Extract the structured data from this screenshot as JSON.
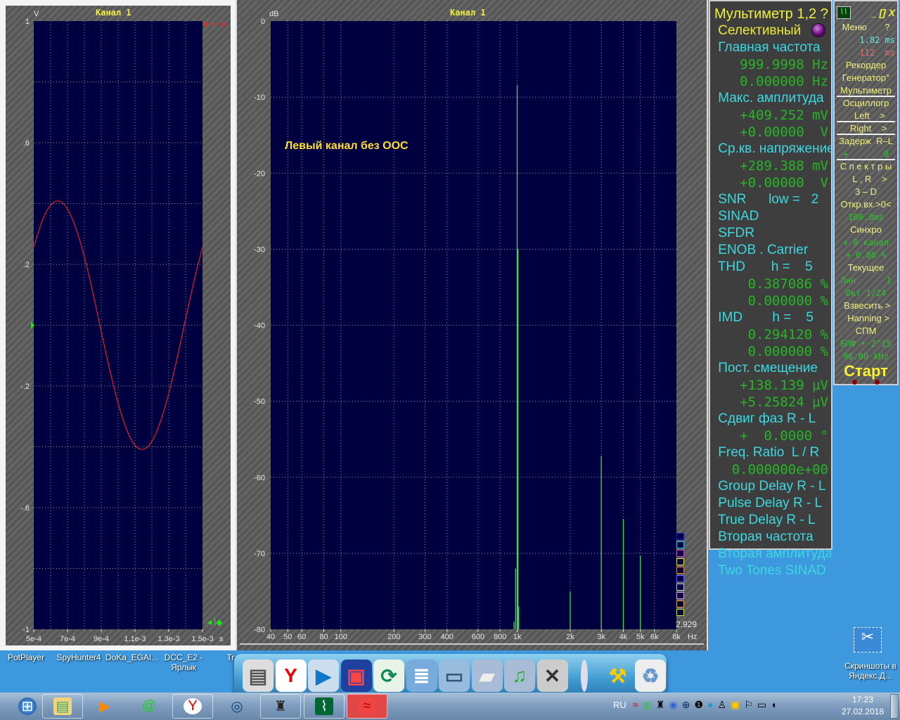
{
  "scope": {
    "title": "Канал 1",
    "unit_label": "V",
    "marker_text": "0 = 0",
    "trigger_icon": "trigger-marker-icon",
    "cursor_controls_icon": "cursor-controls-icon"
  },
  "spectrum": {
    "title": "Канал 1",
    "annotation": "Левый канал без ООС",
    "unit_label": "dB",
    "scale_value": "2.929",
    "legend_colors": [
      "#2020c0",
      "#40c0e0",
      "#c040c0",
      "#e0e040",
      "#e08040",
      "#6060ff",
      "#c0c0e0",
      "#e0a0e0",
      "#e0a040",
      "#c0e040"
    ]
  },
  "chart_data": [
    {
      "type": "line",
      "title": "Канал 1",
      "ylabel": "V",
      "xlabel": "s",
      "xlim": [
        0.0005,
        0.0015
      ],
      "ylim": [
        -1,
        1
      ],
      "grid": true,
      "x_ticks": [
        "5e-4",
        "7e-4",
        "9e-4",
        "1.1e-3",
        "1.3e-3",
        "1.5e-3"
      ],
      "x_tick_values": [
        0.0005,
        0.0007,
        0.0009,
        0.0011,
        0.0013,
        0.0015
      ],
      "y_ticks": [
        "1",
        ".6",
        ".2",
        "-.2",
        "-.6",
        "-1"
      ],
      "y_tick_values": [
        1,
        0.6,
        0.2,
        -0.2,
        -0.6,
        -1
      ],
      "series_color": "#e02020",
      "x": [
        0.0005,
        0.00055,
        0.0006,
        0.00065,
        0.0007,
        0.00075,
        0.0008,
        0.00085,
        0.0009,
        0.00095,
        0.001,
        0.00105,
        0.0011,
        0.00115,
        0.0012,
        0.00125,
        0.0013,
        0.00135,
        0.0014,
        0.00145,
        0.0015
      ],
      "y": [
        0.257,
        0.343,
        0.395,
        0.408,
        0.382,
        0.318,
        0.224,
        0.107,
        -0.021,
        -0.146,
        -0.257,
        -0.343,
        -0.395,
        -0.408,
        -0.382,
        -0.318,
        -0.224,
        -0.107,
        0.021,
        0.146,
        0.257
      ]
    },
    {
      "type": "bar",
      "title": "Канал 1",
      "ylabel": "dB",
      "xlabel": "Hz",
      "x_scale": "log",
      "xlim": [
        40,
        8000
      ],
      "ylim": [
        -80,
        0
      ],
      "grid": true,
      "x_ticks": [
        "40",
        "50",
        "60",
        "80",
        "100",
        "200",
        "300",
        "400",
        "600",
        "800",
        "1k",
        "2k",
        "3k",
        "4k",
        "5k",
        "6k",
        "8k"
      ],
      "x_tick_values": [
        40,
        50,
        60,
        80,
        100,
        200,
        300,
        400,
        600,
        800,
        1000,
        2000,
        3000,
        4000,
        5000,
        6000,
        8000
      ],
      "y_ticks": [
        "0",
        "-10",
        "-20",
        "-30",
        "-40",
        "-50",
        "-60",
        "-70",
        "-80"
      ],
      "y_tick_values": [
        0,
        -10,
        -20,
        -30,
        -40,
        -50,
        -60,
        -70,
        -80
      ],
      "series_color": "#40e040",
      "x": [
        960,
        980,
        1000,
        1010,
        1020,
        2000,
        3000,
        4000,
        5000
      ],
      "y": [
        -79,
        -72,
        -8.4,
        -30,
        -77,
        -75,
        -57.2,
        -65.5,
        -70.3
      ]
    }
  ],
  "multimeter": {
    "rows": [
      {
        "text": "Мультиметр 1,2 ?",
        "kind": "mt"
      },
      {
        "text": " Селективный",
        "kind": "mh"
      },
      {
        "text": " Главная частота",
        "kind": "ml"
      },
      {
        "text": "999.9998 Hz",
        "kind": "mv"
      },
      {
        "text": "0.000000 Hz",
        "kind": "mv"
      },
      {
        "text": " Макс. амплитуда",
        "kind": "ml"
      },
      {
        "text": "+409.252 mV",
        "kind": "mv"
      },
      {
        "text": "+0.00000  V",
        "kind": "mv"
      },
      {
        "text": " Ср.кв. напряжение",
        "kind": "ml"
      },
      {
        "text": "+289.388 mV",
        "kind": "mv"
      },
      {
        "text": "+0.00000  V",
        "kind": "mv"
      },
      {
        "text": " SNR      low =   2",
        "kind": "ml"
      },
      {
        "text": " SINAD",
        "kind": "ml"
      },
      {
        "text": " SFDR",
        "kind": "ml"
      },
      {
        "text": " ENOB . Carrier",
        "kind": "ml"
      },
      {
        "text": " THD       h =    5",
        "kind": "ml"
      },
      {
        "text": "0.387086 %",
        "kind": "mv"
      },
      {
        "text": "0.000000 %",
        "kind": "mv"
      },
      {
        "text": " IMD        h =    5",
        "kind": "ml"
      },
      {
        "text": "0.294120 %",
        "kind": "mv"
      },
      {
        "text": "0.000000 %",
        "kind": "mv"
      },
      {
        "text": " Пост. смещение",
        "kind": "ml"
      },
      {
        "text": "+138.139 µV",
        "kind": "mv"
      },
      {
        "text": "+5.25824 µV",
        "kind": "mv"
      },
      {
        "text": " Сдвиг фаз R - L",
        "kind": "ml"
      },
      {
        "text": "+  0.0000 °",
        "kind": "mv"
      },
      {
        "text": " Freq. Ratio  L / R",
        "kind": "ml"
      },
      {
        "text": "0.000000e+00",
        "kind": "mv"
      },
      {
        "text": " Group Delay R - L",
        "kind": "ml"
      },
      {
        "text": " Pulse Delay R - L",
        "kind": "ml"
      },
      {
        "text": " True Delay R - L",
        "kind": "ml"
      },
      {
        "text": " Вторая частота",
        "kind": "ml"
      },
      {
        "text": " Вторая амплитуда",
        "kind": "ml"
      },
      {
        "text": " Two Tones SINAD",
        "kind": "ml"
      }
    ]
  },
  "control": {
    "window_buttons": [
      "_",
      "[]",
      "X"
    ],
    "rows": [
      {
        "text": "Меню       ?",
        "kind": "",
        "sep": false
      },
      {
        "text": "1.82 ms",
        "kind": "cc",
        "sep": false
      },
      {
        "text": "112  ms",
        "kind": "cp",
        "sep": false
      },
      {
        "text": "Рекордер",
        "kind": "",
        "sep": false
      },
      {
        "text": "Генератор°",
        "kind": "",
        "sep": false
      },
      {
        "text": "Мультиметр",
        "kind": "",
        "sep": true
      },
      {
        "text": "Осциллогр",
        "kind": "",
        "sep": false
      },
      {
        "text": "   Left    >",
        "kind": "",
        "sep": true
      },
      {
        "text": "  Right    >",
        "kind": "",
        "sep": true
      },
      {
        "text": "Задерж  R–L",
        "kind": "",
        "sep": false
      },
      {
        "text": "+       0",
        "kind": "cv",
        "sep": true
      },
      {
        "text": "С п е к т р ы",
        "kind": "",
        "sep": false
      },
      {
        "text": "   L , R    >",
        "kind": "",
        "sep": false
      },
      {
        "text": "3 – D",
        "kind": "",
        "sep": false
      },
      {
        "text": "Откр.вх.>0<",
        "kind": "",
        "sep": false
      },
      {
        "text": "100.0ms",
        "kind": "cv",
        "sep": false
      },
      {
        "text": "Синхро",
        "kind": "",
        "sep": false
      },
      {
        "text": "+ 0 канал",
        "kind": "cv",
        "sep": false
      },
      {
        "text": "+ 0.00 %",
        "kind": "cv",
        "sep": false
      },
      {
        "text": "Текущее",
        "kind": "",
        "sep": false
      },
      {
        "text": "Лин      1",
        "kind": "cv",
        "sep": false
      },
      {
        "text": "Окт 1/24",
        "kind": "cv",
        "sep": false
      },
      {
        "text": " Взвесить >",
        "kind": "",
        "sep": false
      },
      {
        "text": "  Hanning >",
        "kind": "",
        "sep": false
      },
      {
        "text": "СПМ",
        "kind": "",
        "sep": false
      },
      {
        "text": "БПФ • 2^15",
        "kind": "cv",
        "sep": false
      },
      {
        "text": "96.00 kHz",
        "kind": "cv",
        "sep": false
      }
    ],
    "start_label": "Старт"
  },
  "desktop": {
    "icons": [
      "PotPlayer",
      "SpyHunter4",
      "DoKa_EGAI...",
      "DCC_E2 - Ярлык",
      "Tr"
    ],
    "right_icon": "Скриншоты в Яндекс.Д..."
  },
  "dock": {
    "items": [
      "monitor-icon",
      "yandex-browser-icon",
      "media-player-icon",
      "floppy-save-icon",
      "refresh-icon",
      "stacked-windows-icon",
      "tv-icon",
      "folder-icon",
      "music-folder-icon",
      "tools-icon",
      "separator",
      "hammer-icon",
      "recycle-bin-icon"
    ]
  },
  "taskbar": {
    "items": [
      "start-orb-icon",
      "explorer-icon",
      "media-player-icon",
      "mail-agent-icon",
      "yandex-browser-icon",
      "browser-icon",
      "hat-icon",
      "analyzer-icon",
      "waves-icon"
    ],
    "language": "RU",
    "time": "17:23",
    "date": "27.02.2018"
  }
}
